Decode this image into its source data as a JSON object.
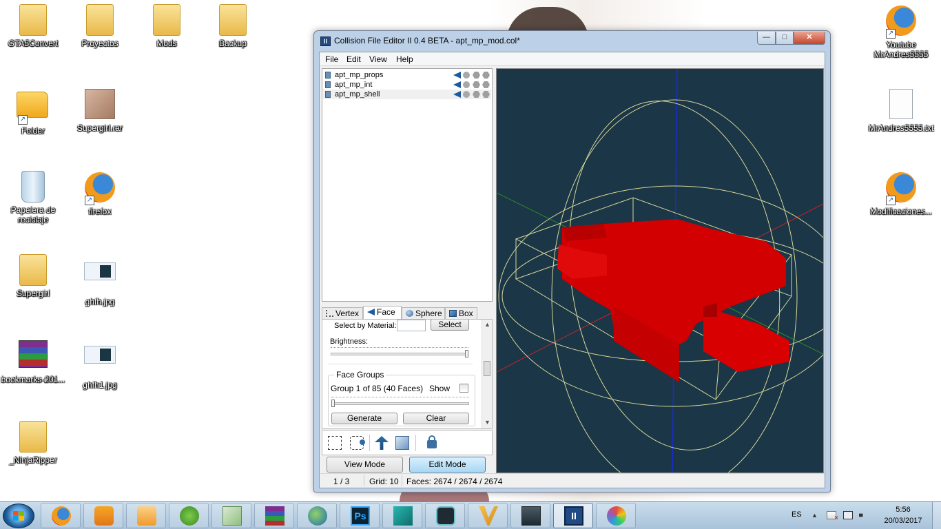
{
  "desktop": {
    "icons": [
      {
        "label": "GTA5Convert",
        "icon": "folder-icon"
      },
      {
        "label": "Proyectos",
        "icon": "folder-icon"
      },
      {
        "label": "Mods",
        "icon": "folder-icon"
      },
      {
        "label": "Backup",
        "icon": "folder-icon"
      },
      {
        "label": "Folder",
        "icon": "folder-shortcut-icon"
      },
      {
        "label": "Supergirl.rar",
        "icon": "rar-archive-icon"
      },
      {
        "label": "Papelera de reciclaje",
        "icon": "recycle-bin-icon"
      },
      {
        "label": "firefox",
        "icon": "firefox-icon"
      },
      {
        "label": "Supergirl",
        "icon": "folder-icon"
      },
      {
        "label": "ghfh.jpg",
        "icon": "image-file-icon"
      },
      {
        "label": "bookmarks-201...",
        "icon": "rar-archive-icon"
      },
      {
        "label": "ghfh1.jpg",
        "icon": "image-file-icon"
      },
      {
        "label": "_NinjaRipper",
        "icon": "folder-icon"
      },
      {
        "label": "Youtube MrAndres5555",
        "icon": "firefox-icon"
      },
      {
        "label": "MrAndres5555.txt",
        "icon": "text-file-icon"
      },
      {
        "label": "Modificaciones...",
        "icon": "firefox-icon"
      }
    ]
  },
  "window": {
    "title": "Collision File Editor II 0.4 BETA - apt_mp_mod.col*",
    "icon_text": "II",
    "controls": {
      "minimize": "—",
      "maximize": "□",
      "close": "✕"
    },
    "menu": [
      "File",
      "Edit",
      "View",
      "Help"
    ],
    "objects": [
      {
        "name": "apt_mp_props",
        "selected": false
      },
      {
        "name": "apt_mp_int",
        "selected": false
      },
      {
        "name": "apt_mp_shell",
        "selected": true
      }
    ],
    "tabs": [
      {
        "label": "Vertex",
        "active": false
      },
      {
        "label": "Face",
        "active": true
      },
      {
        "label": "Sphere",
        "active": false
      },
      {
        "label": "Box",
        "active": false
      }
    ],
    "face_panel": {
      "select_by_material_label": "Select by Material:",
      "select_button": "Select",
      "brightness_label": "Brightness:",
      "face_groups_title": "Face Groups",
      "group_info": "Group 1 of 85 (40 Faces)",
      "show_label": "Show",
      "show_checked": false,
      "generate_button": "Generate",
      "clear_button": "Clear"
    },
    "modes": {
      "view": "View Mode",
      "edit": "Edit Mode",
      "active": "Edit Mode"
    },
    "status": {
      "index": "1 / 3",
      "grid": "Grid: 10",
      "faces": "Faces: 2674 / 2674 / 2674"
    },
    "viewport_colors": {
      "background": "#1b3646",
      "mesh": "#e00000",
      "bounds": "#d8d89a",
      "axis_x": "#c0262b",
      "axis_y": "#2c8a2c",
      "axis_z": "#1a2ccc"
    }
  },
  "taskbar": {
    "apps": [
      "firefox",
      "uc-browser",
      "media-player",
      "clover",
      "notepad",
      "winrar",
      "internet-download-manager",
      "photoshop",
      "3ds-max",
      "sfx-tool",
      "v-app",
      "monitor",
      "collision-file-editor",
      "paint"
    ],
    "active_app": "collision-file-editor",
    "language": "ES",
    "time": "5:56",
    "date": "20/03/2017"
  }
}
